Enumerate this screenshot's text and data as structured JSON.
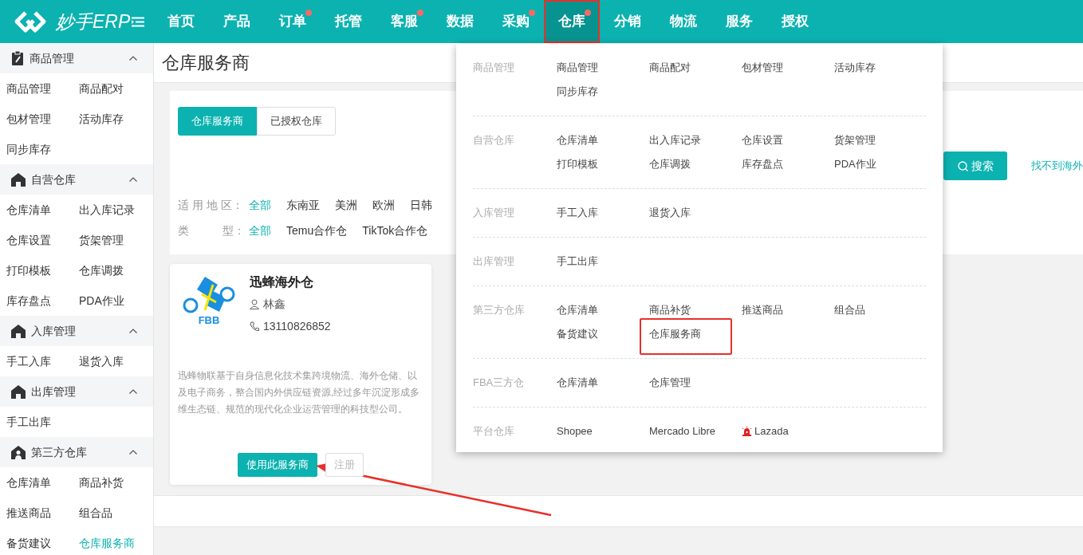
{
  "brand": {
    "name": "妙手ERP"
  },
  "nav": [
    {
      "label": "首页",
      "dot": false,
      "selected": false,
      "highlighted": false
    },
    {
      "label": "产品",
      "dot": false,
      "selected": false,
      "highlighted": false
    },
    {
      "label": "订单",
      "dot": true,
      "selected": false,
      "highlighted": false
    },
    {
      "label": "托管",
      "dot": false,
      "selected": false,
      "highlighted": false
    },
    {
      "label": "客服",
      "dot": true,
      "selected": false,
      "highlighted": false
    },
    {
      "label": "数据",
      "dot": false,
      "selected": false,
      "highlighted": false
    },
    {
      "label": "采购",
      "dot": true,
      "selected": false,
      "highlighted": false
    },
    {
      "label": "仓库",
      "dot": true,
      "selected": true,
      "highlighted": true
    },
    {
      "label": "分销",
      "dot": false,
      "selected": false,
      "highlighted": false
    },
    {
      "label": "物流",
      "dot": false,
      "selected": false,
      "highlighted": false
    },
    {
      "label": "服务",
      "dot": false,
      "selected": false,
      "highlighted": false
    },
    {
      "label": "授权",
      "dot": false,
      "selected": false,
      "highlighted": false
    }
  ],
  "sidebar": {
    "groups": [
      {
        "title": "商品管理",
        "kind": "clipboard",
        "expanded": true,
        "items": [
          {
            "label": "商品管理",
            "selected": false
          },
          {
            "label": "商品配对",
            "selected": false
          },
          {
            "label": "包材管理",
            "selected": false
          },
          {
            "label": "活动库存",
            "selected": false
          },
          {
            "label": "同步库存",
            "selected": false
          }
        ]
      },
      {
        "title": "自营仓库",
        "kind": "house",
        "expanded": true,
        "items": [
          {
            "label": "仓库清单",
            "selected": false
          },
          {
            "label": "出入库记录",
            "selected": false
          },
          {
            "label": "仓库设置",
            "selected": false
          },
          {
            "label": "货架管理",
            "selected": false
          },
          {
            "label": "打印模板",
            "selected": false
          },
          {
            "label": "仓库调拨",
            "selected": false
          },
          {
            "label": "库存盘点",
            "selected": false
          },
          {
            "label": "PDA作业",
            "selected": false
          }
        ]
      },
      {
        "title": "入库管理",
        "kind": "house",
        "expanded": true,
        "items": [
          {
            "label": "手工入库",
            "selected": false
          },
          {
            "label": "退货入库",
            "selected": false
          }
        ]
      },
      {
        "title": "出库管理",
        "kind": "house",
        "expanded": true,
        "items": [
          {
            "label": "手工出库",
            "selected": false
          }
        ]
      },
      {
        "title": "第三方仓库",
        "kind": "person-house",
        "expanded": true,
        "items": [
          {
            "label": "仓库清单",
            "selected": false
          },
          {
            "label": "商品补货",
            "selected": false
          },
          {
            "label": "推送商品",
            "selected": false
          },
          {
            "label": "组合品",
            "selected": false
          },
          {
            "label": "备货建议",
            "selected": false
          },
          {
            "label": "仓库服务商",
            "selected": true
          }
        ]
      }
    ]
  },
  "page": {
    "title": "仓库服务商"
  },
  "tabs": [
    {
      "label": "仓库服务商",
      "selected": true
    },
    {
      "label": "已授权仓库",
      "selected": false
    }
  ],
  "filters": [
    {
      "label": "适 用 地 区：",
      "options": [
        {
          "label": "全部",
          "selected": true
        },
        {
          "label": "东南亚",
          "selected": false
        },
        {
          "label": "美洲",
          "selected": false
        },
        {
          "label": "欧洲",
          "selected": false
        },
        {
          "label": "日韩",
          "selected": false
        }
      ]
    },
    {
      "label": "类　　　型：",
      "options": [
        {
          "label": "全部",
          "selected": true
        },
        {
          "label": "Temu合作仓",
          "selected": false
        },
        {
          "label": "TikTok合作仓",
          "selected": false
        }
      ]
    }
  ],
  "search": {
    "button": "搜索",
    "link": "找不到海外"
  },
  "card": {
    "logo_text": "FBB",
    "name": "迅蜂海外仓",
    "contact": "林鑫",
    "phone": "13110826852",
    "description": "迅蜂物联基于自身信息化技术集跨境物流、海外仓储、以及电子商务，整合国内外供应链资源,经过多年沉淀形成多维生态链、规范的现代化企业运营管理的科技型公司。",
    "annotation_arrow": true,
    "buttons": [
      {
        "label": "使用此服务商",
        "kind": "primary"
      },
      {
        "label": "注册",
        "kind": "plain"
      }
    ]
  },
  "dropdown": {
    "rows": [
      {
        "label": "商品管理",
        "items": [
          {
            "label": "商品管理",
            "highlighted": false
          },
          {
            "label": "商品配对",
            "highlighted": false
          },
          {
            "label": "包材管理",
            "highlighted": false
          },
          {
            "label": "活动库存",
            "highlighted": false
          },
          {
            "label": "同步库存",
            "highlighted": false
          }
        ]
      },
      {
        "label": "自营仓库",
        "items": [
          {
            "label": "仓库清单",
            "highlighted": false
          },
          {
            "label": "出入库记录",
            "highlighted": false
          },
          {
            "label": "仓库设置",
            "highlighted": false
          },
          {
            "label": "货架管理",
            "highlighted": false
          },
          {
            "label": "打印模板",
            "highlighted": false
          },
          {
            "label": "仓库调拨",
            "highlighted": false
          },
          {
            "label": "库存盘点",
            "highlighted": false
          },
          {
            "label": "PDA作业",
            "highlighted": false
          }
        ]
      },
      {
        "label": "入库管理",
        "items": [
          {
            "label": "手工入库",
            "highlighted": false
          },
          {
            "label": "退货入库",
            "highlighted": false
          }
        ]
      },
      {
        "label": "出库管理",
        "items": [
          {
            "label": "手工出库",
            "highlighted": false
          }
        ]
      },
      {
        "label": "第三方仓库",
        "items": [
          {
            "label": "仓库清单",
            "highlighted": false
          },
          {
            "label": "商品补货",
            "highlighted": false
          },
          {
            "label": "推送商品",
            "highlighted": false
          },
          {
            "label": "组合品",
            "highlighted": false
          },
          {
            "label": "备货建议",
            "highlighted": false
          },
          {
            "label": "仓库服务商",
            "highlighted": true
          }
        ]
      },
      {
        "label": "FBA三方仓",
        "items": [
          {
            "label": "仓库清单",
            "highlighted": false
          },
          {
            "label": "仓库管理",
            "highlighted": false
          }
        ]
      },
      {
        "label": "平台仓库",
        "items": [
          {
            "label": "Shopee",
            "highlighted": false
          },
          {
            "label": "Mercado Libre",
            "highlighted": false
          },
          {
            "label": "Lazada",
            "highlighted": false,
            "kind": "alarm"
          }
        ]
      }
    ]
  }
}
